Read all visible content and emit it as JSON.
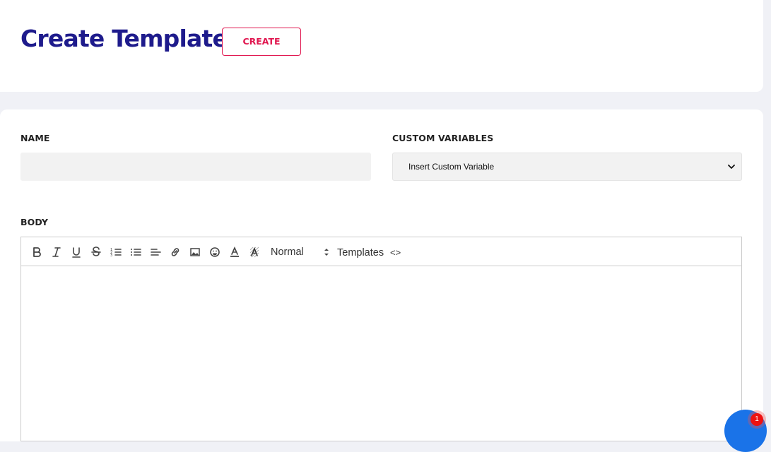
{
  "header": {
    "title": "Create Template",
    "create_label": "CREATE"
  },
  "form": {
    "name_label": "NAME",
    "name_value": "",
    "custom_variables_label": "CUSTOM VARIABLES",
    "custom_variable_selected": "Insert Custom Variable",
    "body_label": "BODY"
  },
  "toolbar": {
    "icons": [
      "bold-icon",
      "italic-icon",
      "underline-icon",
      "strikethrough-icon",
      "ordered-list-icon",
      "bullet-list-icon",
      "align-left-icon",
      "link-icon",
      "image-icon",
      "emoji-icon",
      "text-color-icon",
      "background-color-icon"
    ],
    "heading_selected": "Normal",
    "templates_label": "Templates",
    "code_label": "<>"
  },
  "chat": {
    "badge_count": "1",
    "accent": "#1a73e8"
  },
  "colors": {
    "title": "#1e1b8c",
    "create_button": "#e0164f",
    "background": "#f0f1f6"
  }
}
